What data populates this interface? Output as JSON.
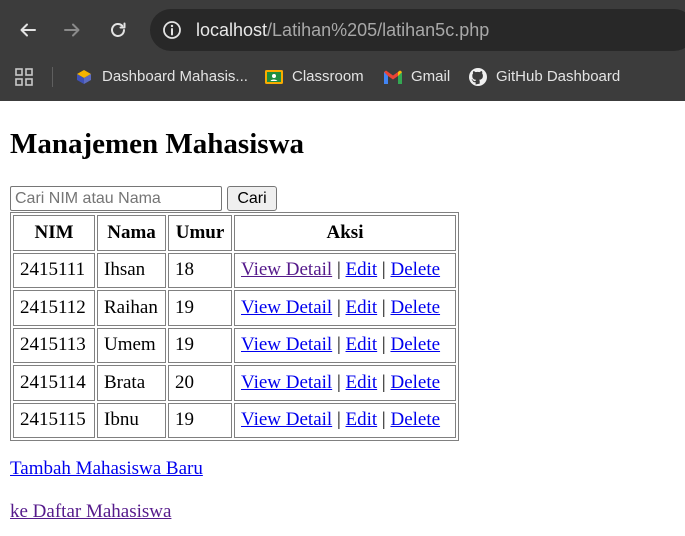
{
  "browser": {
    "url_host": "localhost",
    "url_path": "/Latihan%205/latihan5c.php",
    "bookmarks": [
      {
        "label": "Dashboard Mahasis..."
      },
      {
        "label": "Classroom"
      },
      {
        "label": "Gmail"
      },
      {
        "label": "GitHub Dashboard"
      }
    ],
    "colors": {
      "toolbar": "#3c3c3c",
      "omnibox": "#282828"
    }
  },
  "page": {
    "title": "Manajemen Mahasiswa",
    "search": {
      "placeholder": "Cari NIM atau Nama",
      "value": "",
      "button_label": "Cari"
    },
    "table": {
      "headers": [
        "NIM",
        "Nama",
        "Umur",
        "Aksi"
      ],
      "actions": {
        "view": "View Detail",
        "edit": "Edit",
        "delete": "Delete",
        "separator": "|"
      },
      "rows": [
        {
          "nim": "2415111",
          "nama": "Ihsan",
          "umur": "18"
        },
        {
          "nim": "2415112",
          "nama": "Raihan",
          "umur": "19"
        },
        {
          "nim": "2415113",
          "nama": "Umem",
          "umur": "19"
        },
        {
          "nim": "2415114",
          "nama": "Brata",
          "umur": "20"
        },
        {
          "nim": "2415115",
          "nama": "Ibnu",
          "umur": "19"
        }
      ]
    },
    "links": {
      "add": "Tambah Mahasiswa Baru",
      "list": "ke Daftar Mahasiswa"
    },
    "colors": {
      "link": "#0000ee",
      "visited_link": "#551a8b"
    }
  }
}
